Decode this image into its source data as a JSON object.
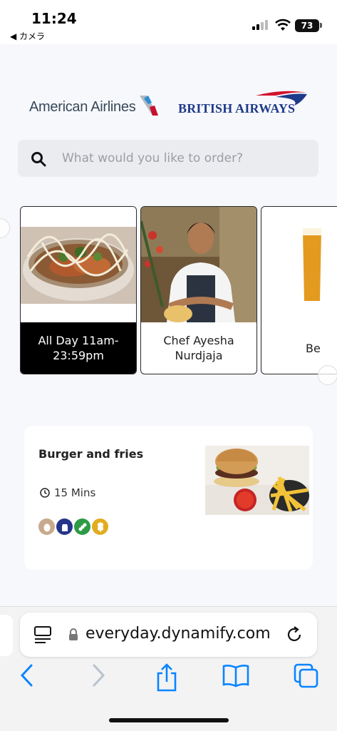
{
  "status_bar": {
    "time": "11:24",
    "back_app": "◀ カメラ",
    "battery": "73"
  },
  "header": {
    "airline_1": "American Airlines",
    "airline_2": "BRITISH AIRWAYS"
  },
  "search": {
    "placeholder": "What would you like to order?"
  },
  "categories": [
    {
      "label": "All Day 11am-23:59pm",
      "selected": true
    },
    {
      "label": "Chef Ayesha Nurdjaja",
      "selected": false
    },
    {
      "label": "Be",
      "selected": false
    }
  ],
  "menu_item": {
    "name": "Burger and fries",
    "time": "15 Mins",
    "allergens": [
      "egg-icon",
      "milk-icon",
      "mustard-icon",
      "gluten-icon"
    ]
  },
  "browser": {
    "url": "everyday.dynamify.com"
  },
  "colors": {
    "accent": "#000000",
    "aa_blue": "#36495a",
    "ba_blue": "#1e3a8a",
    "ba_red": "#d3122c"
  }
}
